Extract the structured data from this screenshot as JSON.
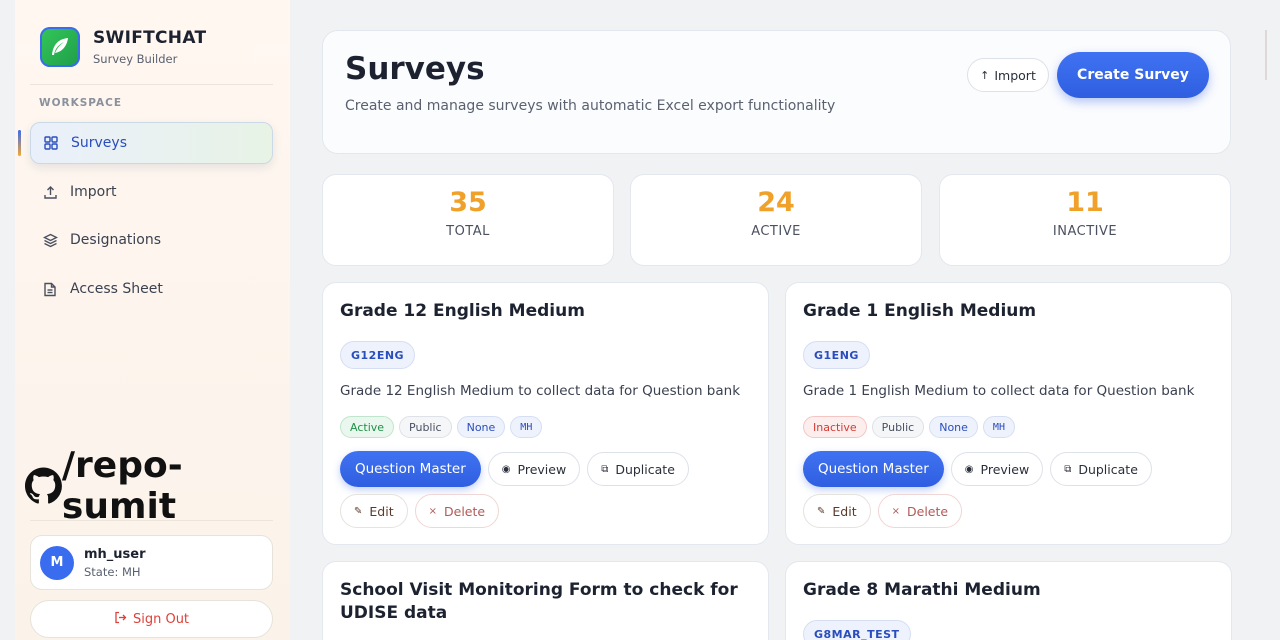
{
  "brand": {
    "title": "SWIFTCHAT",
    "subtitle": "Survey Builder"
  },
  "sidebar": {
    "section_label": "WORKSPACE",
    "items": [
      {
        "label": "Surveys",
        "icon": "grid-icon",
        "active": true
      },
      {
        "label": "Import",
        "icon": "upload-icon",
        "active": false
      },
      {
        "label": "Designations",
        "icon": "layers-icon",
        "active": false
      },
      {
        "label": "Access Sheet",
        "icon": "document-icon",
        "active": false
      }
    ],
    "watermark": "/repo-sumit"
  },
  "user": {
    "initial": "M",
    "name": "mh_user",
    "state": "State: MH"
  },
  "signout_label": "Sign Out",
  "header": {
    "title": "Surveys",
    "subtitle": "Create and manage surveys with automatic Excel export functionality",
    "import_label": "Import",
    "create_label": "Create Survey"
  },
  "stats": [
    {
      "value": "35",
      "label": "TOTAL"
    },
    {
      "value": "24",
      "label": "ACTIVE"
    },
    {
      "value": "11",
      "label": "INACTIVE"
    }
  ],
  "actions": {
    "question_master": "Question Master",
    "preview": "Preview",
    "duplicate": "Duplicate",
    "edit": "Edit",
    "delete": "Delete"
  },
  "surveys": [
    {
      "title": "Grade 12 English Medium",
      "code": "G12ENG",
      "description": "Grade 12 English Medium to collect data for Question bank",
      "status": "Active",
      "visibility": "Public",
      "hierarchy": "None",
      "state": "MH"
    },
    {
      "title": "Grade 1 English Medium",
      "code": "G1ENG",
      "description": "Grade 1 English Medium to collect data for Question bank",
      "status": "Inactive",
      "visibility": "Public",
      "hierarchy": "None",
      "state": "MH"
    },
    {
      "title": "School Visit Monitoring Form to check for UDISE data",
      "code": ""
    },
    {
      "title": "Grade 8 Marathi Medium",
      "code": "G8MAR_TEST"
    }
  ],
  "colors": {
    "accent": "#3a6cf0",
    "stat": "#f0a12a",
    "danger": "#e0403a",
    "success": "#1f8f47"
  }
}
